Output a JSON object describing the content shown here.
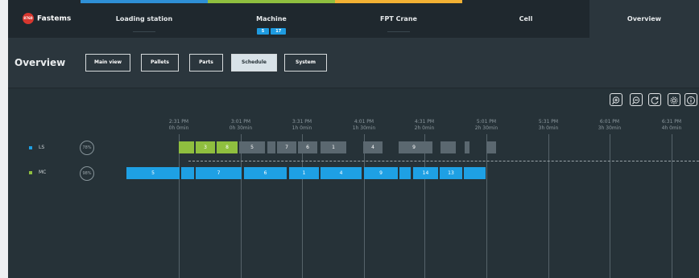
{
  "logo": {
    "mark_text": "8760",
    "name": "Fastems"
  },
  "tabs": [
    {
      "label": "Loading station",
      "accent": "#2e8fd6"
    },
    {
      "label": "Machine",
      "accent": "#8fbf3f",
      "badges": [
        "5",
        "17"
      ]
    },
    {
      "label": "FPT Crane",
      "accent": "#f2b134"
    },
    {
      "label": "Cell"
    },
    {
      "label": "Overview",
      "active": true
    }
  ],
  "page_title": "Overview",
  "nav_buttons": [
    "Main view",
    "Pallets",
    "Parts",
    "Schedule",
    "System"
  ],
  "selected_nav": "Schedule",
  "tools": [
    "zoom-in-icon",
    "zoom-out-icon",
    "refresh-icon",
    "settings-icon",
    "info-icon"
  ],
  "timeline": {
    "ticks": [
      {
        "time": "2:31 PM",
        "elapsed": "0h 0min"
      },
      {
        "time": "3:01 PM",
        "elapsed": "0h 30min"
      },
      {
        "time": "3:31 PM",
        "elapsed": "1h 0min"
      },
      {
        "time": "4:01 PM",
        "elapsed": "1h 30min"
      },
      {
        "time": "4:31 PM",
        "elapsed": "2h 0min"
      },
      {
        "time": "5:01 PM",
        "elapsed": "2h 30min"
      },
      {
        "time": "5:31 PM",
        "elapsed": "3h 0min"
      },
      {
        "time": "6:01 PM",
        "elapsed": "3h 30min"
      },
      {
        "time": "6:31 PM",
        "elapsed": "4h 0min"
      }
    ],
    "rows": [
      {
        "name": "LS",
        "color": "#1ea0e4",
        "utilization": "78%"
      },
      {
        "name": "MC",
        "color": "#8fbf3f",
        "utilization": "98%"
      }
    ],
    "ls_blocks": [
      "",
      "3",
      "8",
      "5",
      "",
      "7",
      "6",
      "1",
      "4",
      "9",
      "",
      "",
      "",
      ""
    ],
    "mc_blocks": [
      "5",
      "",
      "7",
      "6",
      "1",
      "4",
      "9",
      "",
      "14",
      "13",
      ""
    ]
  }
}
